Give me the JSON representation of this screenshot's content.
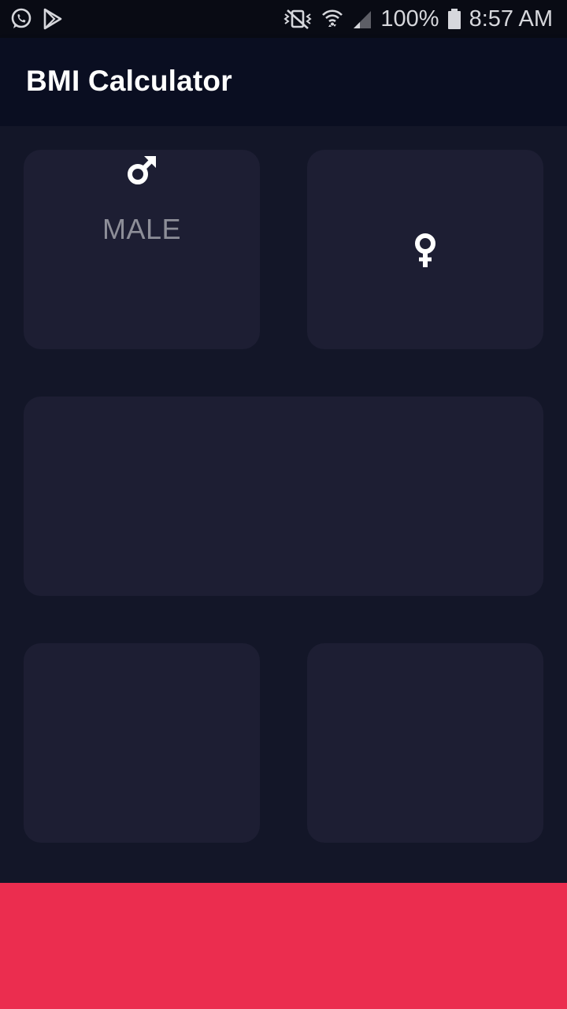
{
  "status_bar": {
    "battery": "100%",
    "time": "8:57 AM",
    "left_icons": [
      "whatsapp-icon",
      "play-store-icon"
    ],
    "right_icons": [
      "vibrate-icon",
      "wifi-icon",
      "signal-icon",
      "battery-icon"
    ]
  },
  "app_bar": {
    "title": "BMI Calculator"
  },
  "gender_cards": {
    "male": {
      "label": "MALE",
      "icon": "male-symbol-icon"
    },
    "female": {
      "label": "",
      "icon": "female-symbol-icon"
    }
  },
  "colors": {
    "background": "#131628",
    "app_bar": "#0a0e21",
    "card": "#1d1e33",
    "label": "#8d8e98",
    "accent": "#eb2d4f"
  }
}
